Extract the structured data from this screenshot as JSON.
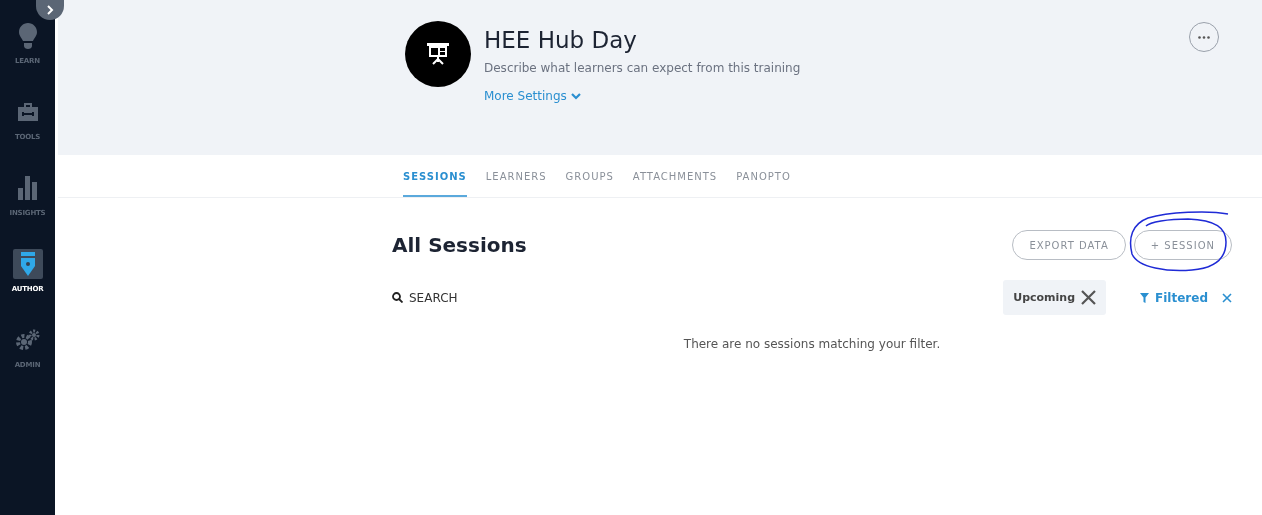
{
  "sidebar": {
    "items": [
      {
        "label": "LEARN",
        "selected": false
      },
      {
        "label": "TOOLS",
        "selected": false
      },
      {
        "label": "INSIGHTS",
        "selected": false
      },
      {
        "label": "AUTHOR",
        "selected": true
      },
      {
        "label": "ADMIN",
        "selected": false
      }
    ]
  },
  "header": {
    "title": "HEE Hub Day",
    "description": "Describe what learners can expect from this training",
    "more_settings": "More Settings"
  },
  "tabs": [
    {
      "label": "SESSIONS",
      "selected": true
    },
    {
      "label": "LEARNERS",
      "selected": false
    },
    {
      "label": "GROUPS",
      "selected": false
    },
    {
      "label": "ATTACHMENTS",
      "selected": false
    },
    {
      "label": "PANOPTO",
      "selected": false
    }
  ],
  "heading": "All Sessions",
  "buttons": [
    "EXPORT DATA",
    "+ SESSION"
  ],
  "search": {
    "label": "SEARCH"
  },
  "filter_chip": "Upcoming",
  "filter_status": "Filtered",
  "empty_message": "There are no sessions matching your filter."
}
